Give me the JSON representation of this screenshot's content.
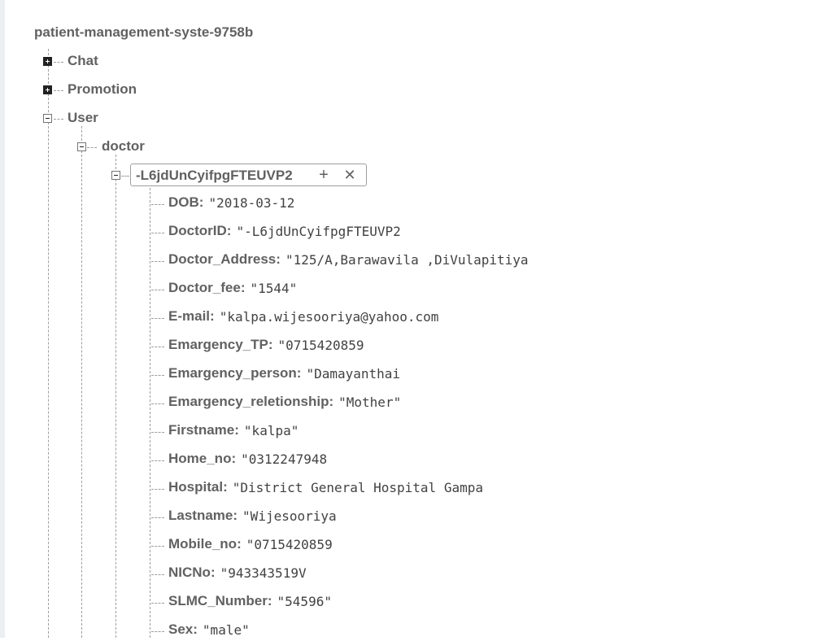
{
  "root": {
    "name": "patient-management-syste-9758b"
  },
  "tree": {
    "chat": {
      "label": "Chat"
    },
    "promotion": {
      "label": "Promotion"
    },
    "user": {
      "label": "User"
    },
    "doctor": {
      "label": "doctor"
    },
    "record": {
      "key": "-L6jdUnCyifpgFTEUVP2",
      "add_symbol": "+",
      "delete_symbol": "✕"
    }
  },
  "fields": [
    {
      "key": "DOB",
      "value": "\"2018-03-12"
    },
    {
      "key": "DoctorID",
      "value": "\"-L6jdUnCyifpgFTEUVP2"
    },
    {
      "key": "Doctor_Address",
      "value": "\"125/A,Barawavila ,DiVulapitiya"
    },
    {
      "key": "Doctor_fee",
      "value": "\"1544\""
    },
    {
      "key": "E-mail",
      "value": "\"kalpa.wijesooriya@yahoo.com"
    },
    {
      "key": "Emargency_TP",
      "value": "\"0715420859"
    },
    {
      "key": "Emargency_person",
      "value": "\"Damayanthai"
    },
    {
      "key": "Emargency_reletionship",
      "value": "\"Mother\""
    },
    {
      "key": "Firstname",
      "value": "\"kalpa\""
    },
    {
      "key": "Home_no",
      "value": "\"0312247948"
    },
    {
      "key": "Hospital",
      "value": "\"District General Hospital Gampa"
    },
    {
      "key": "Lastname",
      "value": "\"Wijesooriya"
    },
    {
      "key": "Mobile_no",
      "value": "\"0715420859"
    },
    {
      "key": "NICNo",
      "value": "\"943343519V"
    },
    {
      "key": "SLMC_Number",
      "value": "\"54596\""
    },
    {
      "key": "Sex",
      "value": "\"male\""
    }
  ],
  "icons": {
    "expand": "plus-square-icon",
    "collapse": "minus-square-icon",
    "add": "plus-icon",
    "delete": "close-icon"
  }
}
